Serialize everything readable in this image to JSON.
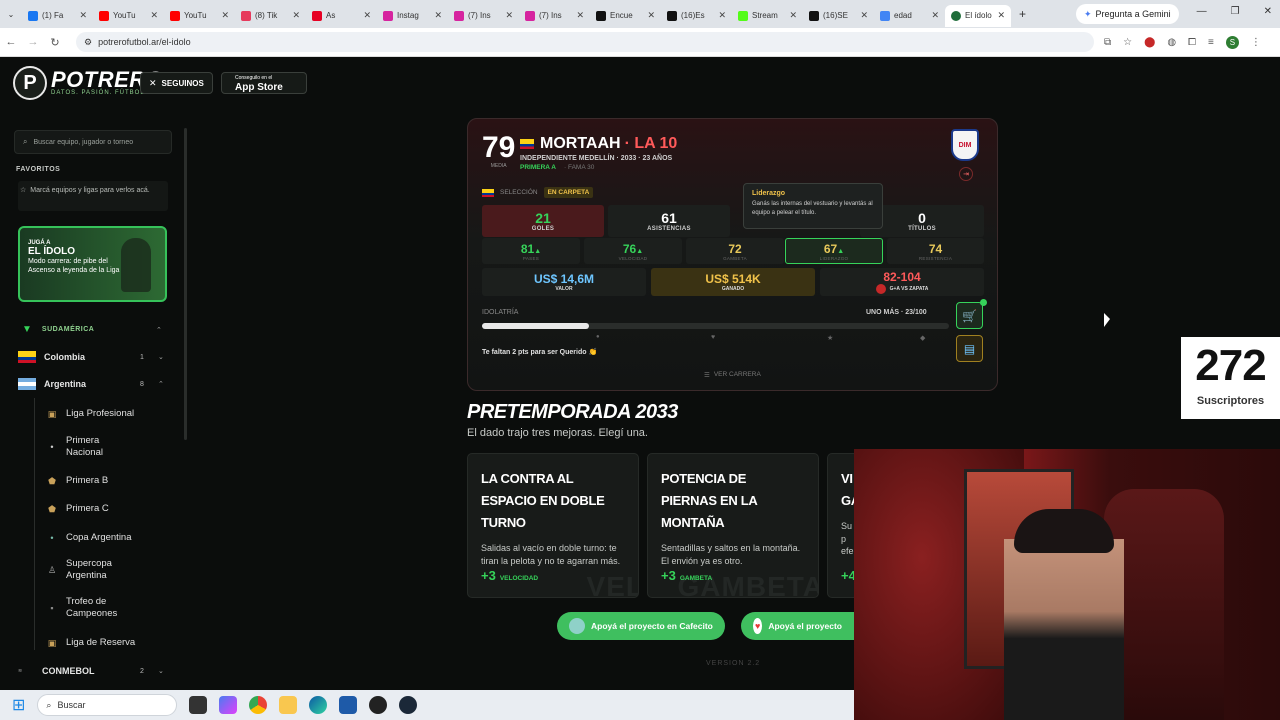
{
  "browser": {
    "tabs": [
      {
        "title": "(1) Fa",
        "color": "#1877f2"
      },
      {
        "title": "YouTu",
        "color": "#ff0000"
      },
      {
        "title": "YouTu",
        "color": "#ff0000"
      },
      {
        "title": "(8) Tik",
        "color": "#e63a5c"
      },
      {
        "title": "As",
        "color": "#e60023"
      },
      {
        "title": "Instag",
        "color": "#d6249f"
      },
      {
        "title": "(7) Ins",
        "color": "#d6249f"
      },
      {
        "title": "(7) Ins",
        "color": "#d6249f"
      },
      {
        "title": "Encue",
        "color": "#111111"
      },
      {
        "title": "(16)Es",
        "color": "#111111"
      },
      {
        "title": "Stream",
        "color": "#53fc18"
      },
      {
        "title": "(16)SE",
        "color": "#111111"
      },
      {
        "title": "edad",
        "color": "#4285f4"
      }
    ],
    "active_tab": {
      "title": "El ídolo",
      "color": "#1f6d3a"
    },
    "gemini_label": "Pregunta a Gemini",
    "url": "potrerofutbol.ar/el-idolo"
  },
  "header": {
    "logo_letter": "P",
    "logo_name": "POTRERO",
    "logo_tagline": "DATOS. PASIÓN. FÚTBOL.",
    "follow_label": "SEGUINOS",
    "appstore_small": "Conseguilo en el",
    "appstore_label": "App Store"
  },
  "sidebar": {
    "search_placeholder": "Buscar equipo, jugador o torneo",
    "favorites_title": "FAVORITOS",
    "favorites_hint": "Marcá equipos y ligas para verlos acá.",
    "promo": {
      "kicker": "JUGÁ A",
      "title": "EL ÍDOLO",
      "text": "Modo carrera: de pibe del Ascenso a leyenda de la Liga"
    },
    "region": "SUDAMÉRICA",
    "countries": [
      {
        "name": "Colombia",
        "count": "1"
      },
      {
        "name": "Argentina",
        "count": "8"
      }
    ],
    "leagues": [
      "Liga Profesional",
      "Primera Nacional",
      "Primera B",
      "Primera C",
      "Copa Argentina",
      "Supercopa Argentina",
      "Trofeo de Campeones",
      "Liga de Reserva"
    ],
    "conmebol": {
      "name": "CONMEBOL",
      "count": "2"
    }
  },
  "player": {
    "rating": "79",
    "rating_label": "MEDIA",
    "name": "MORTAAH",
    "tag": "· LA 10",
    "details": "INDEPENDIENTE MEDELLÍN · 2033 · 23 AÑOS",
    "division": "PRIMERA A",
    "fame": "· FAMA 30",
    "selection_label": "SELECCIÓN",
    "selection_status": "EN CARPETA",
    "club_badge": "DIM",
    "stats": [
      {
        "value": "21",
        "label": "GOLES"
      },
      {
        "value": "61",
        "label": "ASISTENCIAS"
      },
      {
        "value": "0",
        "label": "TÍTULOS"
      }
    ],
    "tooltip": {
      "title": "Liderazgo",
      "text": "Ganás las internas del vestuario y levantás al equipo a pelear el título."
    },
    "attributes": [
      {
        "value": "81",
        "label": "PASES",
        "up": true,
        "color": "#36d35a"
      },
      {
        "value": "76",
        "label": "VELOCIDAD",
        "up": true,
        "color": "#36d35a"
      },
      {
        "value": "72",
        "label": "GAMBETA",
        "up": false,
        "color": "#e8c95a"
      },
      {
        "value": "67",
        "label": "LIDERAZGO",
        "up": true,
        "color": "#e8c95a"
      },
      {
        "value": "74",
        "label": "RESISTENCIA",
        "up": false,
        "color": "#e8c95a"
      }
    ],
    "money": [
      {
        "value": "US$ 14,6M",
        "label": "VALOR",
        "color": "#6ec6ff"
      },
      {
        "value": "US$ 514K",
        "label": "GANADO",
        "color": "#f0c24a"
      },
      {
        "value": "82-104",
        "label": "G+A VS ZAPATA",
        "color": "#ff5a5a"
      }
    ],
    "idolatry_label": "IDOLATRÍA",
    "idolatry_status": "UNO MÁS · 23/100",
    "idolatry_progress": 0.23,
    "next_level_text": "Te faltan 2 pts para ser Querido 👏",
    "career_link": "VER CARRERA"
  },
  "pretemporada": {
    "title": "PRETEMPORADA 2033",
    "subtitle": "El dado trajo tres mejoras. Elegí una.",
    "choices": [
      {
        "title": "LA CONTRA AL ESPACIO EN DOBLE TURNO",
        "desc": "Salidas al vacío en doble turno: te tiran la pelota y no te agarran más.",
        "bonus": "+3",
        "stat": "VELOCIDAD",
        "ghost": "VEL"
      },
      {
        "title": "POTENCIA DE PIERNAS EN LA MONTAÑA",
        "desc": "Sentadillas y saltos en la montaña. El envión ya es otro.",
        "bonus": "+3",
        "stat": "GAMBETA",
        "ghost": "GAMBETA"
      },
      {
        "title": "VI GA",
        "desc": "Su p efe",
        "bonus": "+4",
        "stat": "",
        "ghost": ""
      }
    ],
    "support_cafecito": "Apoyá el proyecto en Cafecito",
    "support_other": "Apoyá el proyecto",
    "version": "VERSION 2.2"
  },
  "overlay": {
    "subs_count": "272",
    "subs_label": "Suscriptores"
  },
  "taskbar": {
    "search_placeholder": "Buscar"
  }
}
